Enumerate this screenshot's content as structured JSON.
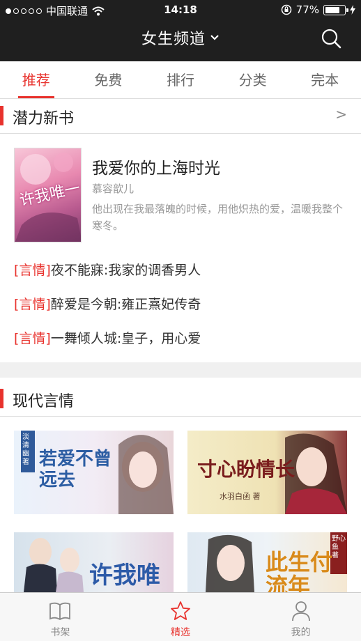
{
  "status_bar": {
    "carrier": "中国联通",
    "time": "14:18",
    "battery": "77%",
    "battery_level": 0.77
  },
  "header": {
    "title": "女生频道"
  },
  "tabs": [
    {
      "label": "推荐",
      "active": true
    },
    {
      "label": "免费",
      "active": false
    },
    {
      "label": "排行",
      "active": false
    },
    {
      "label": "分类",
      "active": false
    },
    {
      "label": "完本",
      "active": false
    }
  ],
  "sections": {
    "potential": {
      "title": "潜力新书",
      "more": ">"
    },
    "modern": {
      "title": "现代言情"
    }
  },
  "featured": {
    "title": "我爱你的上海时光",
    "author": "慕容歆儿",
    "description": "他出现在我最落魄的时候，用他炽热的爱，温暖我整个寒冬。",
    "cover_text": "许我唯一"
  },
  "book_list": [
    {
      "tag": "[言情]",
      "title": "夜不能寐:我家的调香男人"
    },
    {
      "tag": "[言情]",
      "title": "醉爱是今朝:雍正熹妃传奇"
    },
    {
      "tag": "[言情]",
      "title": "一舞倾人城:皇子，用心爱"
    }
  ],
  "grid_covers": [
    {
      "title": "若爱不曾远去",
      "author": "淡清幽 著"
    },
    {
      "title": "寸心盼情长",
      "author": "水羽白函 著"
    },
    {
      "title": "许我唯一",
      "author": ""
    },
    {
      "title": "此生付流年",
      "author": "野心鱼 著"
    }
  ],
  "bottom_nav": [
    {
      "label": "书架",
      "icon": "book-icon",
      "active": false
    },
    {
      "label": "精选",
      "icon": "star-icon",
      "active": true
    },
    {
      "label": "我的",
      "icon": "person-icon",
      "active": false
    }
  ],
  "colors": {
    "accent": "#e8322d",
    "topbar": "#1f1f1f"
  }
}
